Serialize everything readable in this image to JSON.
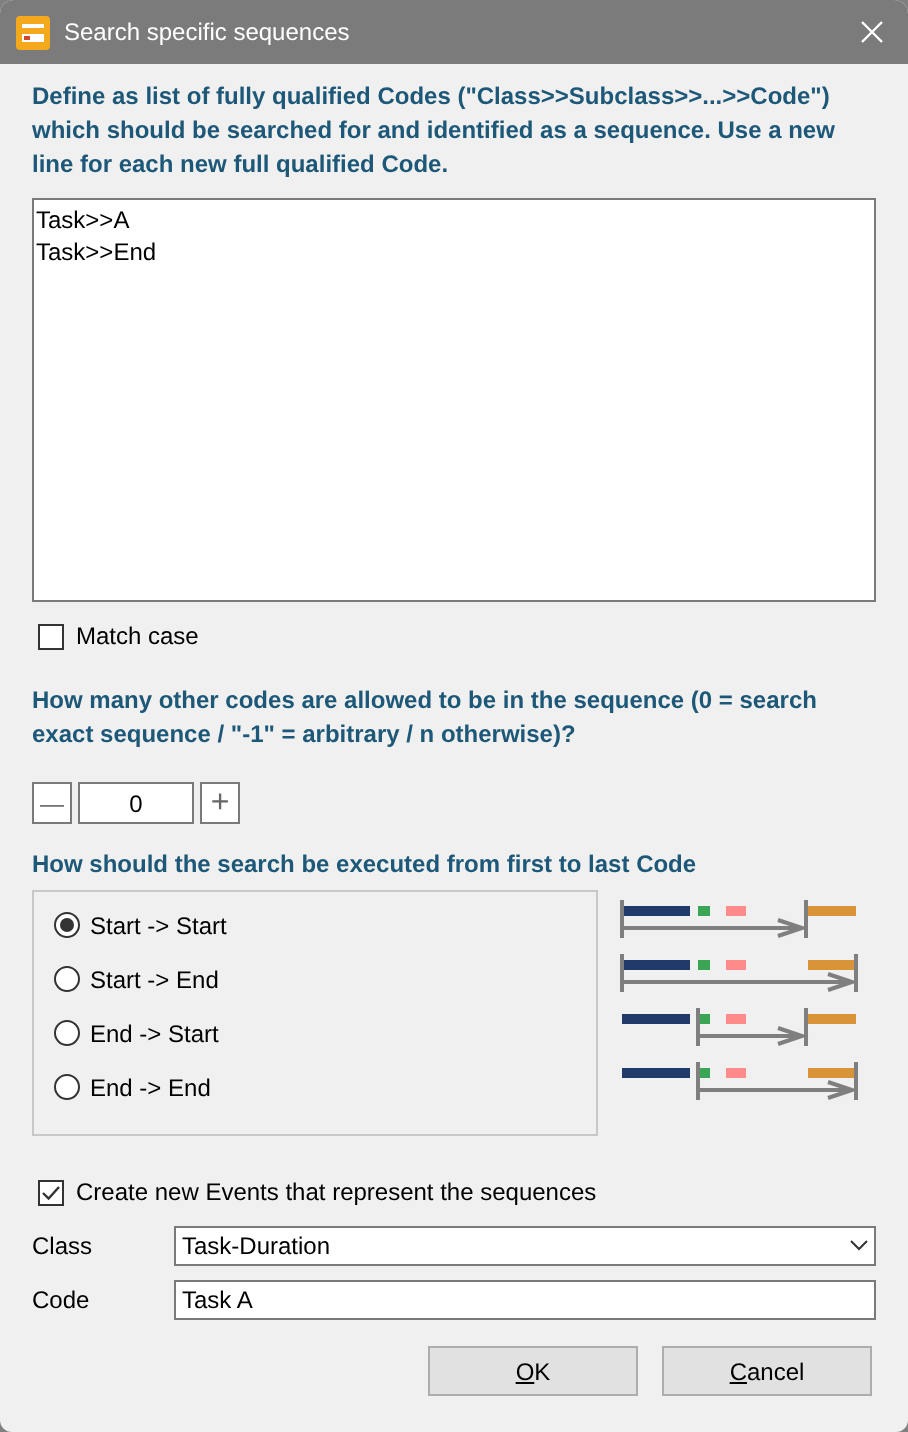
{
  "window": {
    "title": "Search specific sequences"
  },
  "instructions": "Define as list of fully qualified Codes (\"Class>>Subclass>>...>>Code\") which should be searched for and identified as a sequence. Use a new line for each new full qualified Code.",
  "codes_text": "Task>>A\nTask>>End",
  "match_case": {
    "label": "Match case",
    "checked": false
  },
  "allowed_question": "How many other codes are allowed to be in the sequence (0 = search exact sequence / \"-1\" = arbitrary / n otherwise)?",
  "allowed_spinner": {
    "minus": "—",
    "value": "0",
    "plus": "+"
  },
  "execution_question": "How should the search be executed from first to last Code",
  "modes": [
    {
      "label": "Start -> Start",
      "selected": true,
      "kind": "start-start"
    },
    {
      "label": "Start -> End",
      "selected": false,
      "kind": "start-end"
    },
    {
      "label": "End -> Start",
      "selected": false,
      "kind": "end-start"
    },
    {
      "label": "End -> End",
      "selected": false,
      "kind": "end-end"
    }
  ],
  "create_events": {
    "label": "Create new Events that represent the sequences",
    "checked": true
  },
  "class_field": {
    "label": "Class",
    "value": "Task-Duration"
  },
  "code_field": {
    "label": "Code",
    "value": "Task A"
  },
  "buttons": [
    "OK",
    "Cancel"
  ]
}
